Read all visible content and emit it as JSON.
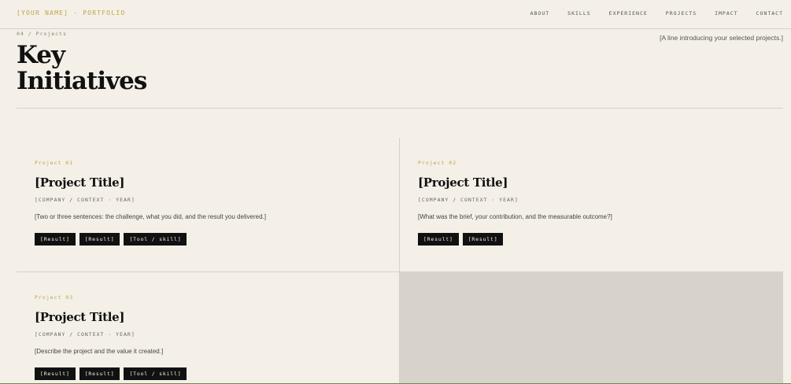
{
  "header": {
    "brand": "[YOUR NAME] · PORTFOLIO",
    "nav": [
      "ABOUT",
      "SKILLS",
      "EXPERIENCE",
      "PROJECTS",
      "IMPACT",
      "CONTACT"
    ]
  },
  "section": {
    "eyebrow": "04 / Projects",
    "title_line1": "Key",
    "title_line2": "Initiatives",
    "intro": "[A line introducing your selected projects.]"
  },
  "projects": [
    {
      "label": "Project 01",
      "title": "[Project Title]",
      "meta": "[COMPANY / CONTEXT · YEAR]",
      "desc": "[Two or three sentences: the challenge, what you did, and the result you delivered.]",
      "tags": [
        "[Result]",
        "[Result]",
        "[Tool / skill]"
      ]
    },
    {
      "label": "Project 02",
      "title": "[Project Title]",
      "meta": "[COMPANY / CONTEXT · YEAR]",
      "desc": "[What was the brief, your contribution, and the measurable outcome?]",
      "tags": [
        "[Result]",
        "[Result]"
      ]
    },
    {
      "label": "Project 03",
      "title": "[Project Title]",
      "meta": "[COMPANY / CONTEXT · YEAR]",
      "desc": "[Describe the project and the value it created.]",
      "tags": [
        "[Result]",
        "[Result]",
        "[Tool / skill]"
      ]
    }
  ],
  "colors": {
    "background": "#f4f0e8",
    "accent": "#c4a24a",
    "tag_bg": "#111111",
    "filler": "#d7d3cb"
  }
}
